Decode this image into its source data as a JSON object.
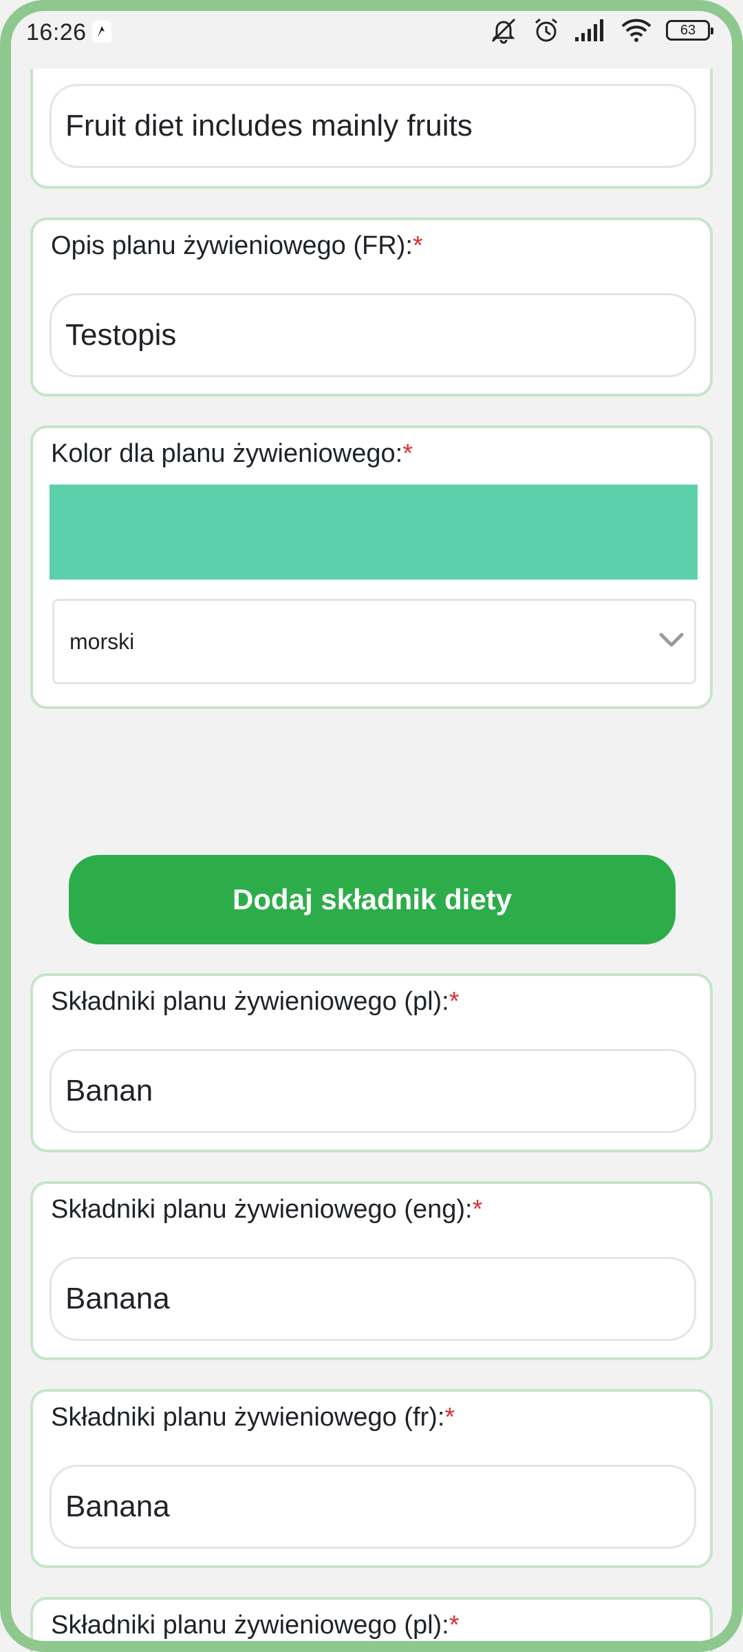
{
  "status_bar": {
    "time": "16:26",
    "battery_level": "63"
  },
  "form": {
    "partial_field": {
      "value": "Fruit diet includes mainly fruits"
    },
    "description_fr": {
      "label": "Opis planu żywieniowego (FR):",
      "required_mark": "*",
      "value": "Testopis"
    },
    "color": {
      "label": "Kolor dla planu żywieniowego:",
      "required_mark": "*",
      "swatch_color": "#5ccfab",
      "selected_option": "morski"
    },
    "add_ingredient_button": "Dodaj składnik diety",
    "ingredients": [
      {
        "label": "Składniki planu żywieniowego (pl):",
        "required_mark": "*",
        "value": "Banan"
      },
      {
        "label": "Składniki planu żywieniowego (eng):",
        "required_mark": "*",
        "value": "Banana"
      },
      {
        "label": "Składniki planu żywieniowego (fr):",
        "required_mark": "*",
        "value": "Banana"
      },
      {
        "label": "Składniki planu żywieniowego (pl):",
        "required_mark": "*",
        "value": ""
      }
    ]
  },
  "colors": {
    "frame": "#8ec88f",
    "card_border": "#c7e5c8",
    "button": "#2dad4a",
    "required": "#e03131"
  }
}
